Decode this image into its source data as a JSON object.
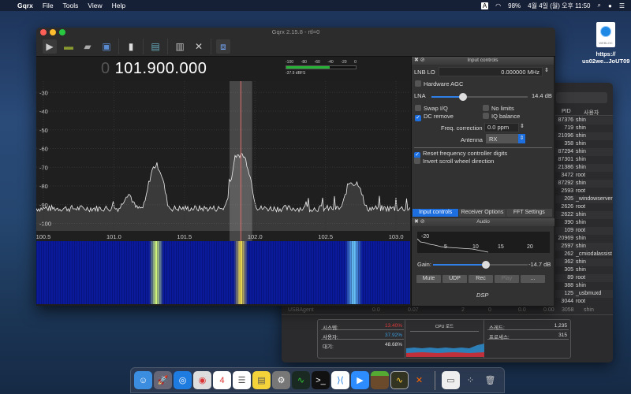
{
  "menubar": {
    "app": "Gqrx",
    "items": [
      "File",
      "Tools",
      "View",
      "Help"
    ],
    "input": "A",
    "battery": "98%",
    "datetime": "4월 4일 (월) 오후 11:50"
  },
  "desktop_icon": {
    "label1": "https://",
    "label2": "us02we...JoUT09",
    "badge": "WEBLOC"
  },
  "gqrx": {
    "title": "Gqrx 2.15.8 - rtl=0",
    "frequency_prefix": "0",
    "frequency": "101.900.000",
    "meter": {
      "scale": [
        "-100",
        "-80",
        "-60",
        "-40",
        "-20",
        "0"
      ],
      "level_dbfs": -37.9,
      "label": "-37.9 dBFS"
    },
    "spectrum": {
      "y_ticks": [
        -30,
        -40,
        -50,
        -60,
        -70,
        -80,
        -90,
        -100
      ],
      "x_ticks": [
        "100.5",
        "101.0",
        "101.5",
        "102.0",
        "102.5",
        "103.0"
      ],
      "x_range_mhz": [
        100.45,
        103.1
      ],
      "y_range_db": [
        -104,
        -24
      ],
      "noise_floor_db": -92,
      "center_mhz": 101.9,
      "filter_width_mhz": 0.16,
      "peaks": [
        {
          "mhz": 101.1,
          "db": -85,
          "w": 0.03
        },
        {
          "mhz": 101.3,
          "db": -69,
          "w": 0.035
        },
        {
          "mhz": 101.9,
          "db": -63,
          "w": 0.04
        },
        {
          "mhz": 102.68,
          "db": -78,
          "w": 0.03
        },
        {
          "mhz": 102.73,
          "db": -79,
          "w": 0.025
        }
      ]
    },
    "input_controls": {
      "title": "Input controls",
      "lnb_label": "LNB LO",
      "lnb_value": "0.000000 MHz",
      "hardware_agc": "Hardware AGC",
      "lna_label": "LNA",
      "lna_value": "14.4 dB",
      "lna_fraction": 0.33,
      "swap_iq": "Swap I/Q",
      "no_limits": "No limits",
      "dc_remove": "DC remove",
      "iq_balance": "IQ balance",
      "freq_corr_label": "Freq. correction",
      "freq_corr_value": "0.0 ppm",
      "antenna_label": "Antenna",
      "antenna_value": "RX",
      "reset_digits": "Reset frequency controller digits",
      "invert_scroll": "Invert scroll wheel direction"
    },
    "tabs": [
      "Input controls",
      "Receiver Options",
      "FFT Settings"
    ],
    "audio": {
      "title": "Audio",
      "fft_labels": [
        "-20",
        "5",
        "10",
        "15",
        "20"
      ],
      "gain_label": "Gain:",
      "gain_value": "-14.7 dB",
      "gain_fraction": 0.56,
      "buttons": [
        "Mute",
        "UDP",
        "Rec",
        "Play",
        "..."
      ],
      "dsp": "DSP"
    }
  },
  "activity": {
    "headers": [
      "PID",
      "사용자"
    ],
    "rows": [
      [
        "87376",
        "shin"
      ],
      [
        "719",
        "shin"
      ],
      [
        "21096",
        "shin"
      ],
      [
        "358",
        "shin"
      ],
      [
        "87294",
        "shin"
      ],
      [
        "87301",
        "shin"
      ],
      [
        "21386",
        "shin"
      ],
      [
        "3472",
        "root"
      ],
      [
        "87292",
        "shin"
      ],
      [
        "2593",
        "root"
      ],
      [
        "205",
        "_windowserver"
      ],
      [
        "2626",
        "root"
      ],
      [
        "2622",
        "shin"
      ],
      [
        "390",
        "shin"
      ],
      [
        "109",
        "root"
      ],
      [
        "20969",
        "shin"
      ],
      [
        "2597",
        "shin"
      ],
      [
        "262",
        "_cmiodalassist"
      ],
      [
        "362",
        "shin"
      ],
      [
        "305",
        "shin"
      ],
      [
        "89",
        "root"
      ],
      [
        "388",
        "shin"
      ],
      [
        "125",
        "_usbmuxd"
      ],
      [
        "3044",
        "root"
      ]
    ],
    "bottom_row": [
      "USBAgent",
      "0.0",
      "0.07",
      "2",
      "0",
      "0.0",
      "0.00",
      "3058",
      "shin"
    ],
    "stats": {
      "system_label": "시스템:",
      "system": "13.40%",
      "user_label": "사용자:",
      "user": "37.92%",
      "idle_label": "대기:",
      "idle": "48.68%",
      "chart_title": "CPU 로드",
      "threads_label": "스레드:",
      "threads": "1,235",
      "procs_label": "프로세스:",
      "procs": "315"
    },
    "colors": {
      "system": "#e03a3a",
      "user": "#3a9ad9"
    }
  }
}
